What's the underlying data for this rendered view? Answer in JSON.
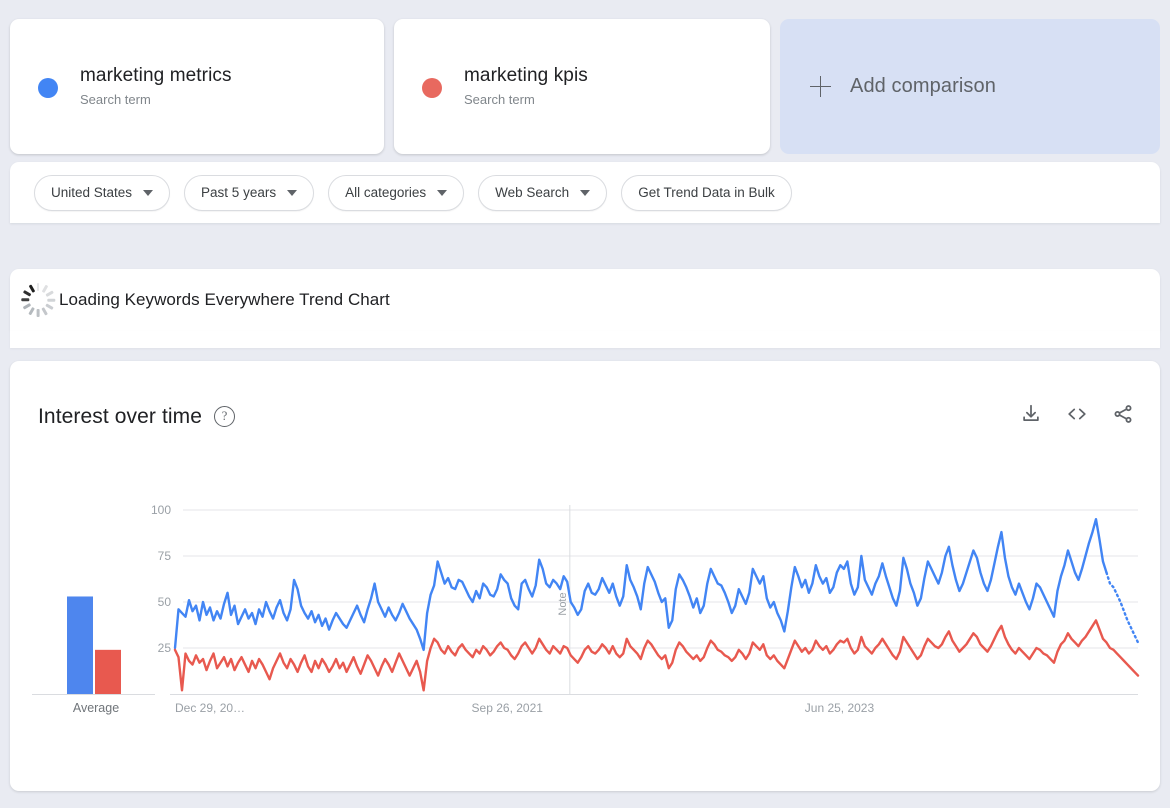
{
  "comparison": {
    "terms": [
      {
        "name": "marketing metrics",
        "type": "Search term",
        "color": "#4285f4"
      },
      {
        "name": "marketing kpis",
        "type": "Search term",
        "color": "#e8695f"
      }
    ],
    "add_comparison_label": "Add comparison"
  },
  "filters": {
    "location": "United States",
    "time_range": "Past 5 years",
    "category": "All categories",
    "search_type": "Web Search",
    "bulk_button": "Get Trend Data in Bulk"
  },
  "loading": {
    "message": "Loading Keywords Everywhere Trend Chart"
  },
  "chart_panel": {
    "title": "Interest over time",
    "help_tooltip": "?",
    "actions": [
      {
        "name": "download",
        "label": "Download CSV"
      },
      {
        "name": "embed",
        "label": "Embed code"
      },
      {
        "name": "share",
        "label": "Share"
      }
    ]
  },
  "chart_data": {
    "type": "line",
    "title": "Interest over time",
    "xlabel": "",
    "ylabel": "",
    "ylim": [
      0,
      100
    ],
    "yticks": [
      25,
      50,
      75,
      100
    ],
    "grid": true,
    "legend_position": "top-cards",
    "x_tick_labels": [
      "Dec 29, 20…",
      "Sep 26, 2021",
      "Jun 25, 2023"
    ],
    "x_tick_positions": [
      0.0,
      0.345,
      0.69
    ],
    "annotation": {
      "label": "Note",
      "x_fraction": 0.41
    },
    "partial_data_tail": true,
    "average_bars": {
      "label": "Average",
      "values": [
        53,
        24
      ],
      "colors": [
        "#4e86ee",
        "#e8594f"
      ]
    },
    "series": [
      {
        "name": "marketing metrics",
        "color": "#4285f4",
        "values": [
          25,
          46,
          44,
          42,
          51,
          45,
          48,
          40,
          50,
          43,
          47,
          40,
          45,
          41,
          49,
          55,
          43,
          48,
          38,
          42,
          46,
          41,
          44,
          38,
          46,
          42,
          50,
          45,
          41,
          47,
          51,
          44,
          40,
          46,
          62,
          57,
          48,
          44,
          41,
          45,
          39,
          43,
          37,
          41,
          35,
          40,
          44,
          41,
          38,
          36,
          40,
          44,
          48,
          43,
          39,
          46,
          52,
          60,
          50,
          46,
          42,
          47,
          43,
          40,
          44,
          49,
          45,
          41,
          38,
          35,
          30,
          24,
          44,
          54,
          59,
          72,
          66,
          60,
          63,
          58,
          57,
          62,
          61,
          57,
          53,
          50,
          56,
          52,
          60,
          58,
          54,
          53,
          57,
          65,
          62,
          60,
          52,
          48,
          46,
          60,
          62,
          57,
          53,
          59,
          73,
          68,
          60,
          58,
          62,
          60,
          57,
          64,
          61,
          50,
          47,
          43,
          46,
          56,
          60,
          55,
          54,
          57,
          63,
          59,
          55,
          60,
          53,
          48,
          53,
          70,
          62,
          58,
          53,
          46,
          60,
          69,
          65,
          61,
          55,
          50,
          52,
          36,
          40,
          57,
          65,
          62,
          58,
          53,
          47,
          52,
          44,
          48,
          60,
          68,
          64,
          60,
          59,
          55,
          50,
          44,
          48,
          57,
          53,
          49,
          55,
          68,
          64,
          60,
          64,
          52,
          47,
          50,
          44,
          40,
          34,
          45,
          58,
          69,
          64,
          58,
          62,
          55,
          60,
          70,
          64,
          60,
          63,
          55,
          58,
          66,
          70,
          68,
          72,
          60,
          54,
          58,
          75,
          62,
          58,
          54,
          60,
          64,
          71,
          64,
          58,
          52,
          48,
          56,
          74,
          68,
          60,
          55,
          48,
          52,
          63,
          72,
          68,
          64,
          60,
          66,
          75,
          80,
          70,
          62,
          56,
          60,
          66,
          72,
          78,
          74,
          66,
          60,
          56,
          62,
          71,
          80,
          88,
          74,
          64,
          58,
          54,
          60,
          55,
          50,
          46,
          52,
          60,
          58,
          54,
          50,
          46,
          42,
          56,
          64,
          70,
          78,
          72,
          66,
          62,
          68,
          75,
          82,
          88,
          95,
          84,
          72,
          66,
          60,
          58,
          54,
          50,
          45,
          40,
          36,
          32,
          28
        ]
      },
      {
        "name": "marketing kpis",
        "color": "#e8594f",
        "values": [
          24,
          20,
          2,
          22,
          18,
          16,
          21,
          17,
          19,
          13,
          18,
          22,
          14,
          17,
          20,
          15,
          19,
          13,
          17,
          20,
          16,
          12,
          18,
          14,
          19,
          16,
          12,
          8,
          14,
          18,
          22,
          17,
          14,
          19,
          16,
          12,
          17,
          21,
          15,
          12,
          18,
          14,
          19,
          16,
          12,
          15,
          19,
          14,
          17,
          12,
          16,
          20,
          15,
          11,
          16,
          21,
          18,
          14,
          10,
          15,
          19,
          16,
          12,
          17,
          22,
          18,
          14,
          10,
          14,
          18,
          12,
          2,
          18,
          25,
          30,
          28,
          24,
          22,
          26,
          23,
          21,
          25,
          27,
          24,
          22,
          20,
          24,
          22,
          26,
          24,
          21,
          23,
          26,
          28,
          25,
          24,
          21,
          19,
          22,
          26,
          28,
          25,
          22,
          25,
          30,
          27,
          24,
          22,
          26,
          24,
          22,
          26,
          25,
          21,
          19,
          17,
          20,
          24,
          26,
          23,
          22,
          24,
          27,
          25,
          22,
          26,
          22,
          20,
          22,
          30,
          26,
          24,
          22,
          19,
          25,
          29,
          27,
          24,
          21,
          19,
          21,
          14,
          17,
          24,
          28,
          26,
          23,
          21,
          19,
          21,
          18,
          20,
          25,
          29,
          27,
          24,
          23,
          21,
          20,
          18,
          20,
          24,
          22,
          19,
          22,
          28,
          26,
          24,
          27,
          21,
          19,
          21,
          18,
          16,
          14,
          19,
          24,
          29,
          26,
          23,
          25,
          22,
          24,
          29,
          26,
          24,
          26,
          22,
          24,
          27,
          29,
          28,
          30,
          25,
          22,
          24,
          31,
          26,
          24,
          22,
          25,
          27,
          30,
          27,
          24,
          21,
          19,
          23,
          31,
          28,
          25,
          22,
          19,
          21,
          26,
          30,
          28,
          26,
          25,
          27,
          31,
          34,
          29,
          26,
          23,
          25,
          27,
          30,
          33,
          31,
          27,
          25,
          23,
          26,
          30,
          34,
          37,
          31,
          27,
          24,
          22,
          25,
          23,
          21,
          19,
          22,
          25,
          24,
          22,
          21,
          19,
          17,
          23,
          27,
          29,
          33,
          30,
          28,
          26,
          29,
          31,
          34,
          37,
          40,
          35,
          30,
          28,
          25,
          24,
          22,
          20,
          18,
          16,
          14,
          12,
          10
        ]
      }
    ]
  }
}
